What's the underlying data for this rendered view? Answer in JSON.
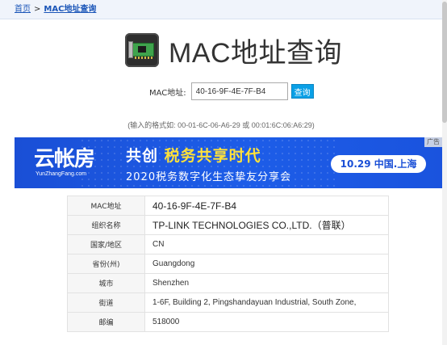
{
  "breadcrumb": {
    "home": "首页",
    "separator": ">",
    "current": "MAC地址查询"
  },
  "header": {
    "title": "MAC地址查询",
    "icon": "network-card-icon"
  },
  "search": {
    "label": "MAC地址:",
    "value": "40-16-9F-4E-7F-B4",
    "button": "查询"
  },
  "hint": "(输入的格式如: 00-01-6C-06-A6-29 或 00:01:6C:06:A6:29)",
  "banner": {
    "logo": "云帐房",
    "logo_sub": "YunZhangFang.com",
    "headline_a": "共创",
    "headline_b": "税务共享时代",
    "subline": "2020税务数字化生态挚友分享会",
    "date_place": "10.29 中国.上海",
    "ad_tag": "广告"
  },
  "results": [
    {
      "key": "MAC地址",
      "value": "40-16-9F-4E-7F-B4"
    },
    {
      "key": "组织名称",
      "value": "TP-LINK TECHNOLOGIES CO.,LTD.（普联）"
    },
    {
      "key": "国家/地区",
      "value": "CN"
    },
    {
      "key": "省份(州)",
      "value": "Guangdong"
    },
    {
      "key": "城市",
      "value": "Shenzhen"
    },
    {
      "key": "街道",
      "value": "1-6F, Building 2, Pingshandayuan Industrial, South Zone,"
    },
    {
      "key": "邮编",
      "value": "518000"
    }
  ],
  "colors": {
    "accent": "#0aa0e6",
    "link": "#1a55b8",
    "banner": "#1a4fd6"
  }
}
